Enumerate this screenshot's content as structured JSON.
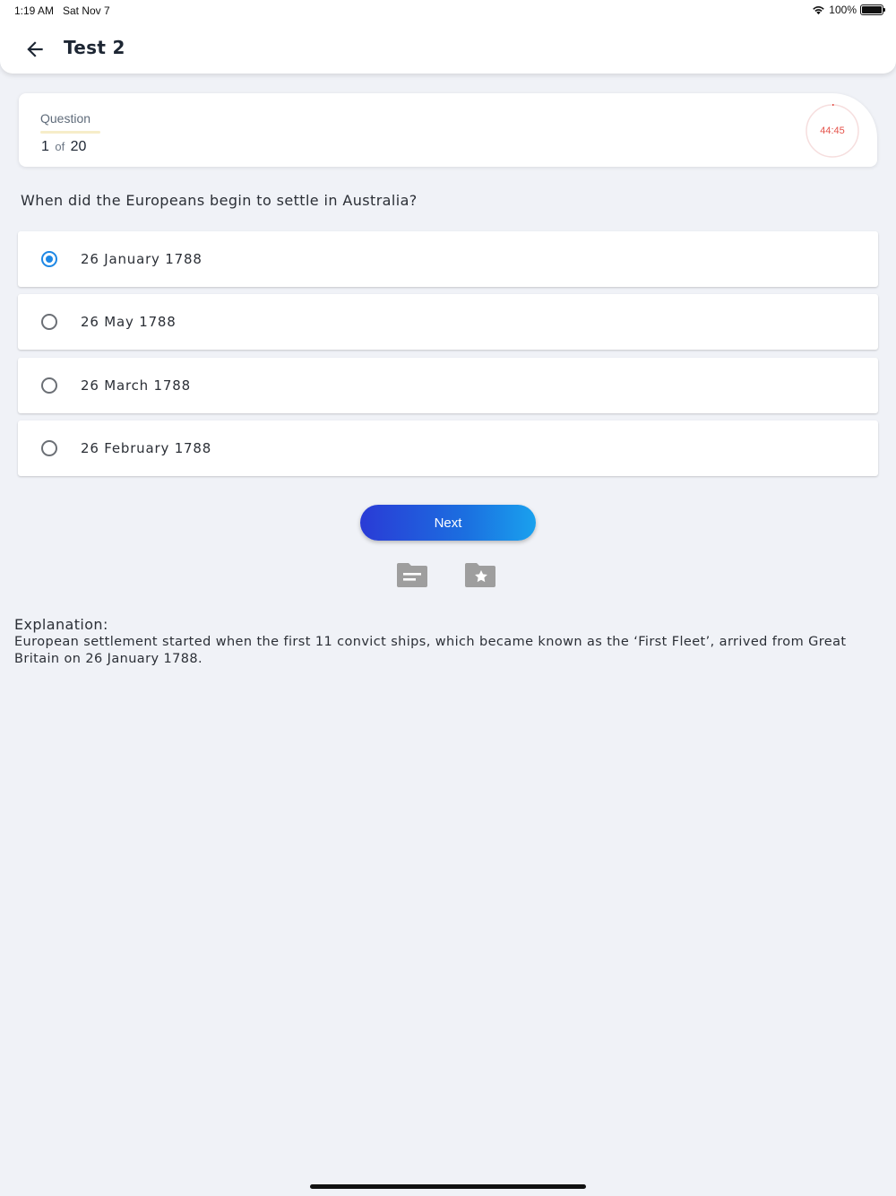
{
  "status_bar": {
    "time": "1:19 AM",
    "date": "Sat Nov 7",
    "battery": "100%"
  },
  "header": {
    "title": "Test 2",
    "back_icon": "arrow-left-icon"
  },
  "question_card": {
    "label": "Question",
    "current": "1",
    "of_label": "of",
    "total": "20",
    "timer": "44:45",
    "timer_color": "#e5534b"
  },
  "question": {
    "text": "When did the Europeans begin to settle in Australia?",
    "options": [
      {
        "label": "26 January 1788",
        "selected": true
      },
      {
        "label": "26 May 1788",
        "selected": false
      },
      {
        "label": "26 March 1788",
        "selected": false
      },
      {
        "label": "26 February 1788",
        "selected": false
      }
    ]
  },
  "actions": {
    "next_label": "Next",
    "icons": [
      "folder-notes-icon",
      "folder-star-icon"
    ]
  },
  "explanation": {
    "heading": "Explanation:",
    "body": "European settlement started when the first 11 convict ships, which became known as the ‘First Fleet’, arrived from Great Britain on 26 January 1788."
  },
  "colors": {
    "accent": "#1e88e5",
    "background": "#f0f2f7",
    "button_gradient_start": "#2a3bd6",
    "button_gradient_end": "#1aa1ee"
  }
}
